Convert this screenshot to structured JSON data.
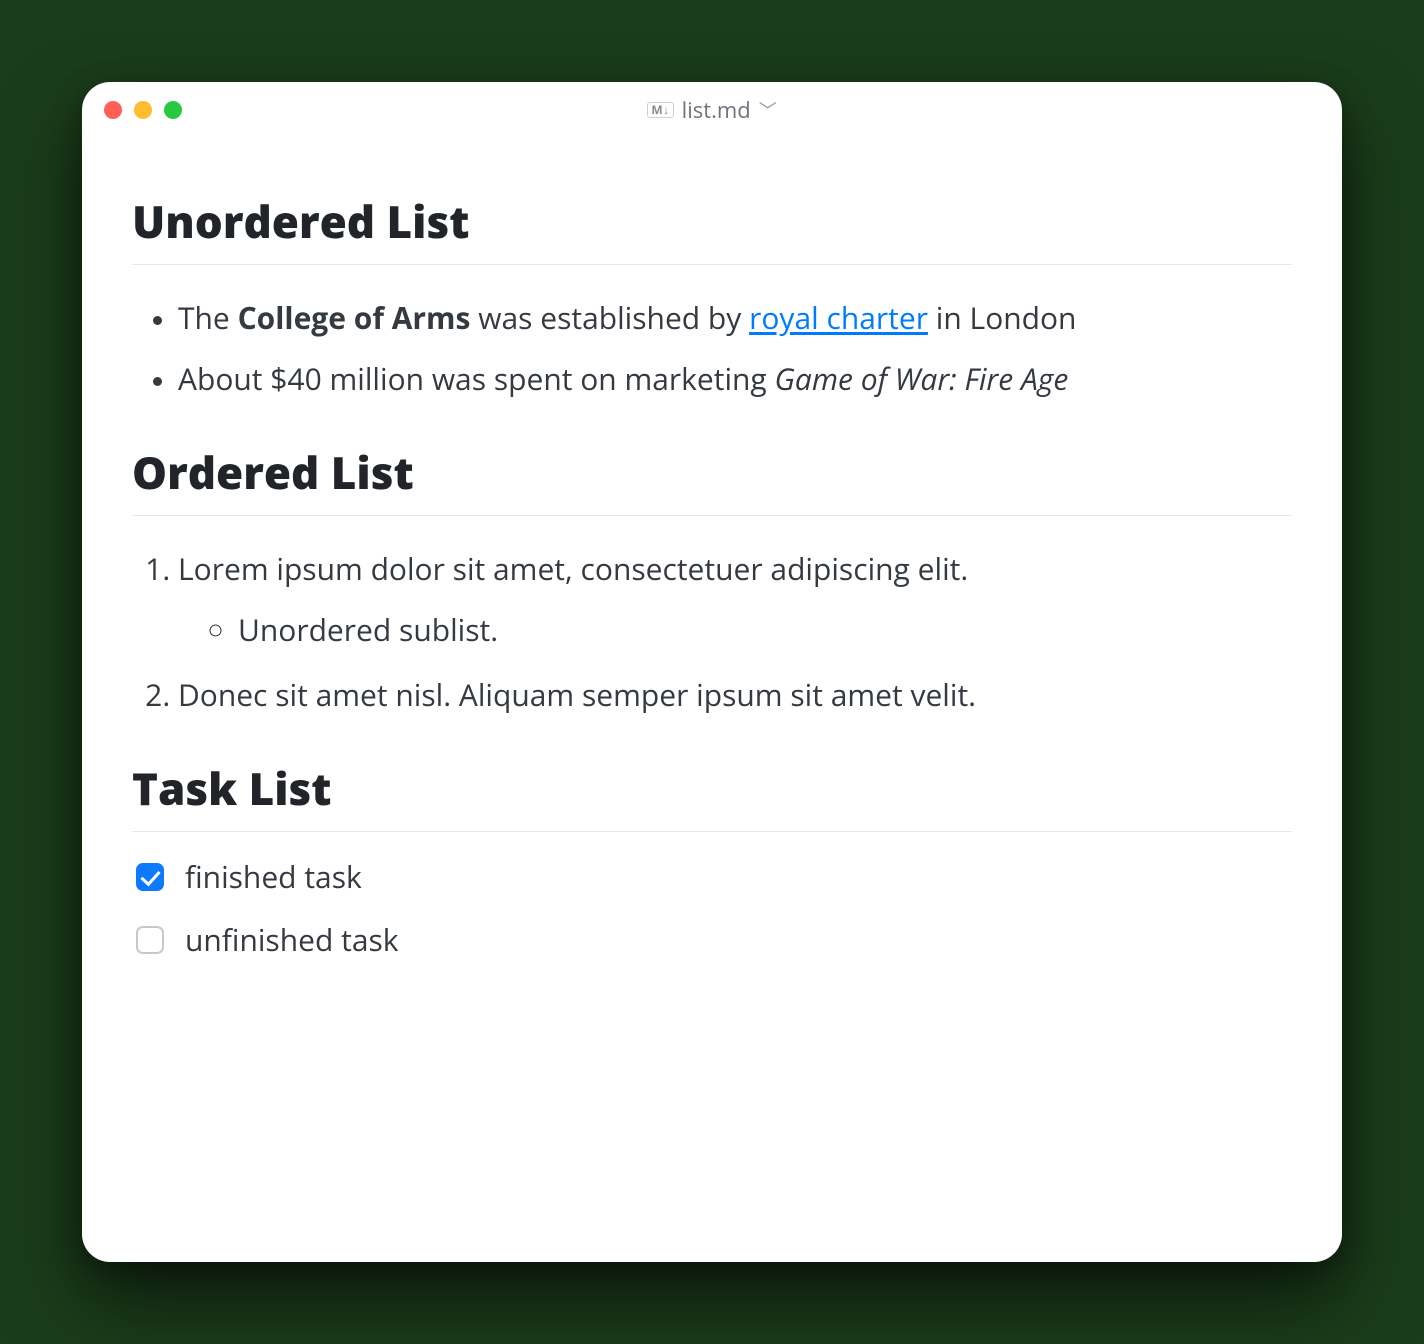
{
  "window": {
    "filetype_badge": "M↓",
    "title": "list.md"
  },
  "sections": {
    "unordered": {
      "heading": "Unordered List",
      "items": [
        {
          "pre": "The ",
          "bold": "College of Arms",
          "mid": " was established by ",
          "link_text": "royal charter",
          "post": " in London"
        },
        {
          "pre": "About $40 million was spent on marketing ",
          "italic": "Game of War: Fire Age"
        }
      ]
    },
    "ordered": {
      "heading": "Ordered List",
      "items": [
        {
          "text": "Lorem ipsum dolor sit amet, consectetuer adipiscing elit.",
          "sublist": [
            "Unordered sublist."
          ]
        },
        {
          "text": "Donec sit amet nisl. Aliquam semper ipsum sit amet velit."
        }
      ]
    },
    "tasks": {
      "heading": "Task List",
      "items": [
        {
          "label": "finished task",
          "done": true
        },
        {
          "label": "unfinished task",
          "done": false
        }
      ]
    }
  }
}
